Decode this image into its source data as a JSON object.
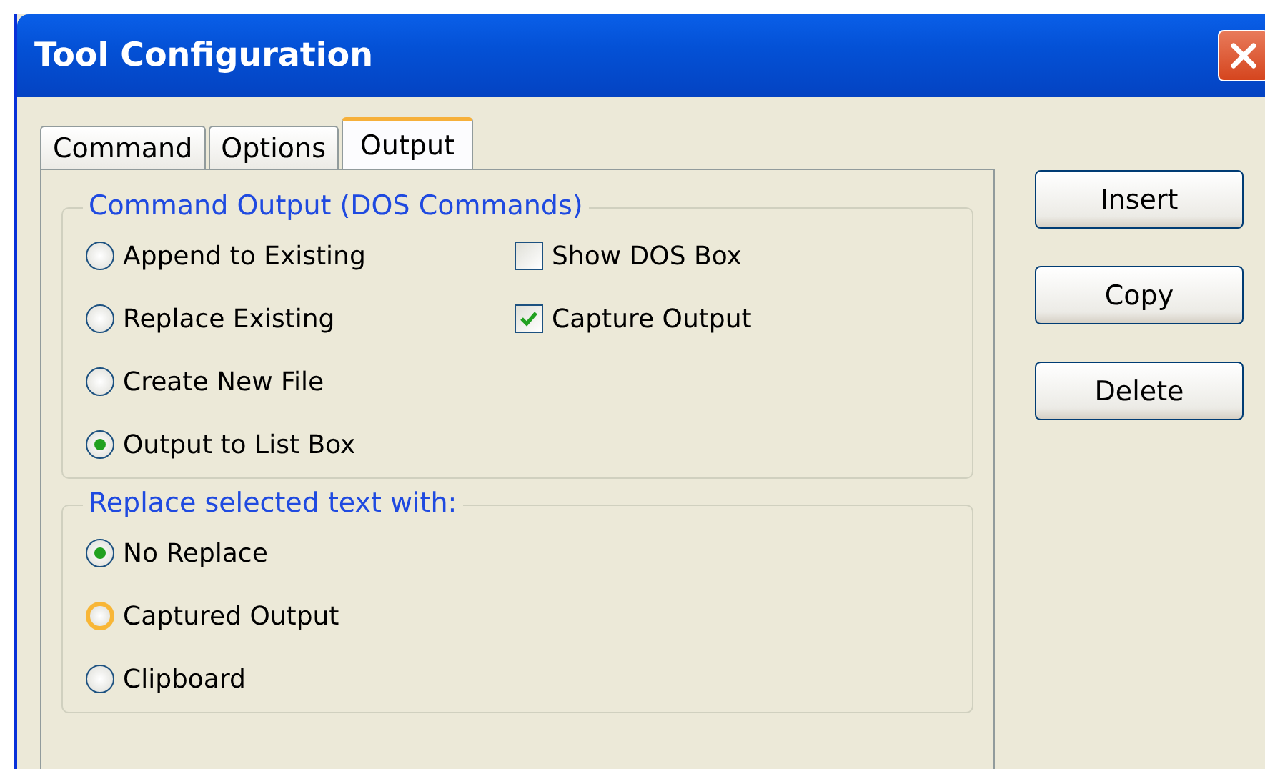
{
  "window": {
    "title": "Tool Configuration"
  },
  "tabs": [
    {
      "label": "Command",
      "selected": false
    },
    {
      "label": "Options",
      "selected": false
    },
    {
      "label": "Output",
      "selected": true
    }
  ],
  "groups": [
    {
      "title": "Command Output (DOS Commands)",
      "radios": [
        {
          "label": "Append to Existing",
          "selected": false,
          "hovered": false
        },
        {
          "label": "Replace Existing",
          "selected": false,
          "hovered": false
        },
        {
          "label": "Create New File",
          "selected": false,
          "hovered": false
        },
        {
          "label": "Output to List Box",
          "selected": true,
          "hovered": false
        }
      ],
      "checkboxes": [
        {
          "label": "Show DOS Box",
          "checked": false
        },
        {
          "label": "Capture Output",
          "checked": true
        }
      ]
    },
    {
      "title": "Replace selected text with:",
      "radios": [
        {
          "label": "No Replace",
          "selected": true,
          "hovered": false
        },
        {
          "label": "Captured Output",
          "selected": false,
          "hovered": true
        },
        {
          "label": "Clipboard",
          "selected": false,
          "hovered": false
        }
      ]
    }
  ],
  "buttons": [
    "Insert",
    "Copy",
    "Delete"
  ]
}
